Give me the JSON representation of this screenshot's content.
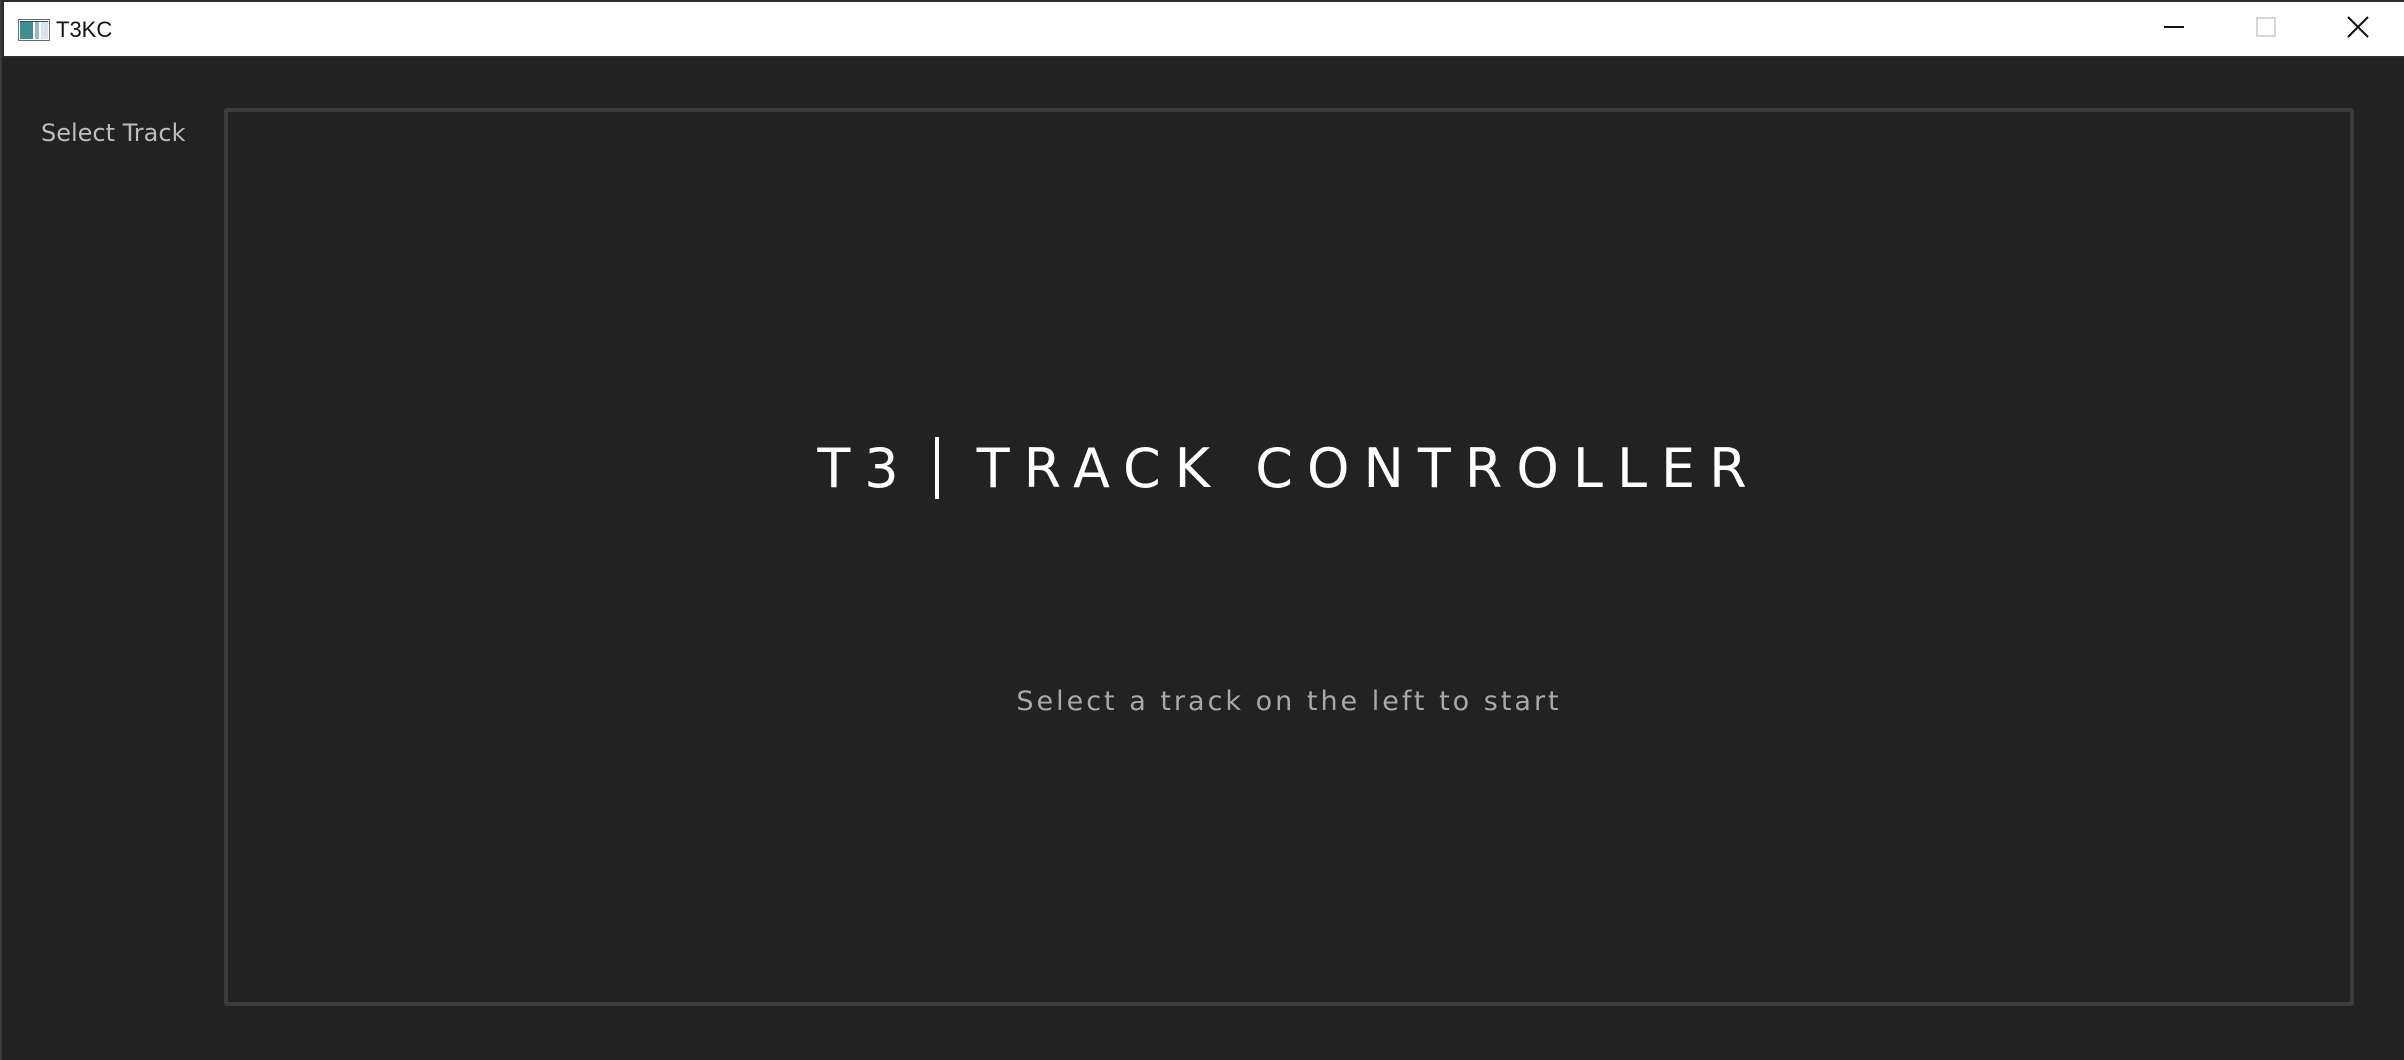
{
  "window": {
    "title": "T3KC",
    "icon": "app-window-icon",
    "controls": {
      "minimize_icon": "minimize-icon",
      "maximize_icon": "maximize-icon",
      "close_icon": "close-icon"
    }
  },
  "sidebar": {
    "label": "Select Track"
  },
  "main": {
    "headline_left": "T3",
    "headline_right": "TRACK CONTROLLER",
    "subtitle": "Select a track on the left to start"
  },
  "colors": {
    "background": "#222222",
    "panel_border": "#3c3c3c",
    "headline": "#ffffff",
    "subtitle": "#a9a9a9",
    "sidebar_text": "#bdbdbd"
  }
}
